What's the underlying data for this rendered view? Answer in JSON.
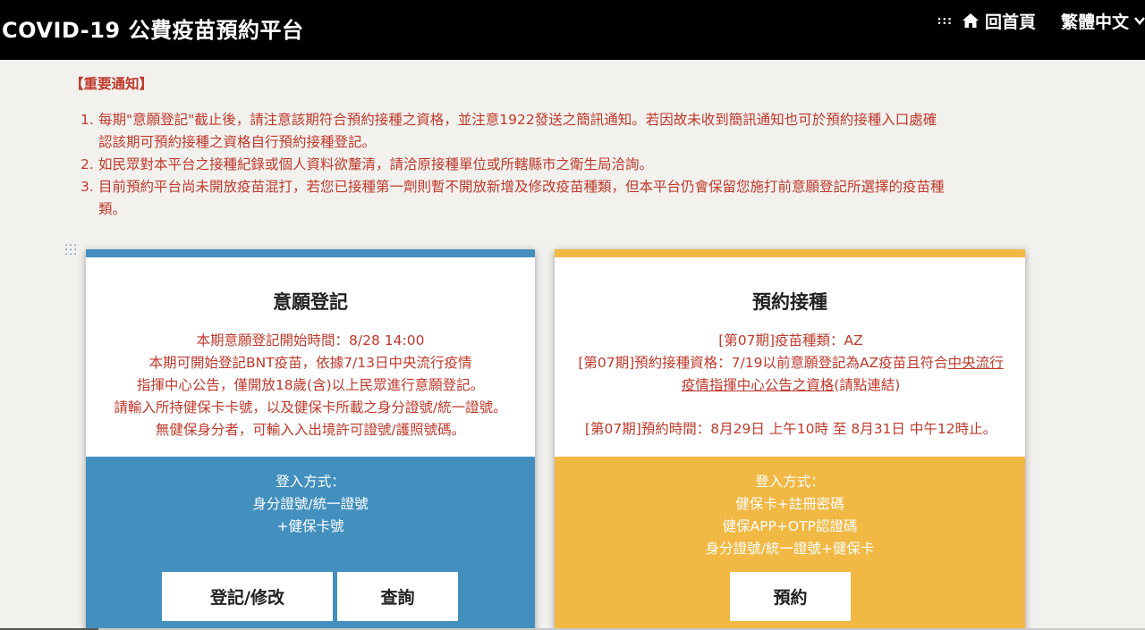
{
  "header": {
    "title": "COVID-19 公費疫苗預約平台",
    "home_label": "回首頁",
    "language_label": "繁體中文",
    "icons": {
      "menu": "grid-dots-icon",
      "home": "home-icon",
      "caret": "chevron-down-icon"
    }
  },
  "notice": {
    "title": "【重要通知】",
    "items": [
      {
        "num": "1.",
        "lines": [
          "每期\"意願登記\"截止後，請注意該期符合預約接種之資格，並注意1922發送之簡訊通知。若因故未收到簡訊通知也可於預約接種入口處確",
          "認該期可預約接種之資格自行預約接種登記。"
        ]
      },
      {
        "num": "2.",
        "lines": [
          "如民眾對本平台之接種紀錄或個人資料欲釐清，請洽原接種單位或所轄縣市之衛生局洽詢。"
        ]
      },
      {
        "num": "3.",
        "lines": [
          "目前預約平台尚未開放疫苗混打，若您已接種第一劑則暫不開放新增及修改疫苗種類，但本平台仍會保留您施打前意願登記所選擇的疫苗種",
          "類。"
        ]
      }
    ]
  },
  "registration_card": {
    "title": "意願登記",
    "info": [
      "本期意願登記開始時間：8/28 14:00",
      "本期可開始登記BNT疫苗，依據7/13日中央流行疫情",
      "指揮中心公告，僅開放18歲(含)以上民眾進行意願登記。",
      "請輸入所持健保卡卡號，以及健保卡所載之身分證號/統一證號。",
      "無健保身分者，可輸入入出境許可證號/護照號碼。"
    ],
    "login_title": "登入方式：",
    "login_methods": [
      "身分證號/統一證號",
      "+健保卡號"
    ],
    "register_button": "登記/修改",
    "query_button": "查詢",
    "color": "#4390bf"
  },
  "booking_card": {
    "title": "預約接種",
    "vaccine_type": "[第07期]疫苗種類：AZ",
    "eligibility_prefix": "[第07期]預約接種資格：7/19以前意願登記為AZ疫苗且符合",
    "eligibility_link_1": "中央流行",
    "eligibility_link_2": "疫情指揮中心公告之資格",
    "eligibility_suffix": "(請點連結)",
    "booking_time": "[第07期]預約時間：8月29日 上午10時 至 8月31日 中午12時止。",
    "login_title": "登入方式：",
    "login_methods": [
      "健保卡+註冊密碼",
      "健保APP+OTP認證碼",
      "身分證號/統一證號+健保卡"
    ],
    "book_button": "預約",
    "color": "#f2b844"
  },
  "colors": {
    "header_bg": "#000000",
    "notice_text": "#c0392b",
    "page_bg": "#f2f1ee"
  }
}
